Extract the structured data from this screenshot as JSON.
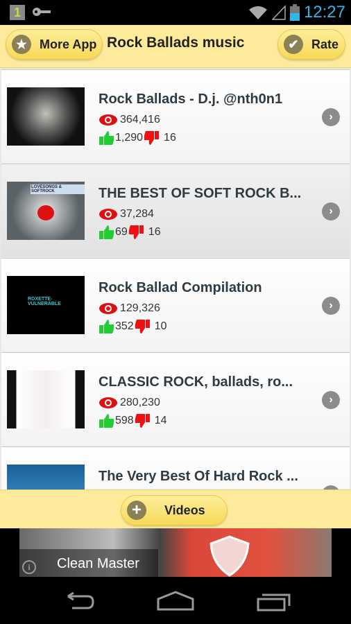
{
  "status_bar": {
    "notification": "1",
    "time": "12:27",
    "icons": [
      "key-icon",
      "wifi-icon",
      "signal-icon",
      "battery-icon"
    ]
  },
  "header": {
    "more_app_label": "More App",
    "title": "Rock Ballads music",
    "rate_label": "Rate"
  },
  "items": [
    {
      "title": "Rock Ballads - D.j. @nth0n1",
      "views": "364,416",
      "likes": "1,290",
      "dislikes": "16"
    },
    {
      "title": "THE BEST OF SOFT ROCK B...",
      "views": "37,284",
      "likes": "69",
      "dislikes": "16",
      "thumb_text": "LOVESONGS & SOFTROCK"
    },
    {
      "title": "Rock Ballad Compilation",
      "views": "129,326",
      "likes": "352",
      "dislikes": "10",
      "thumb_text": "ROXETTE-\nVULNERABLE"
    },
    {
      "title": "CLASSIC ROCK, ballads, ro...",
      "views": "280,230",
      "likes": "598",
      "dislikes": "14"
    },
    {
      "title": "The Very Best Of Hard Rock ...",
      "views": "",
      "likes": "",
      "dislikes": ""
    }
  ],
  "footer": {
    "videos_label": "Videos"
  },
  "ad": {
    "brand": "Clean Master",
    "info": "i"
  },
  "colors": {
    "header_bg": "#fdeb9b",
    "time": "#33b5e5",
    "like": "#22cc33",
    "dislike": "#ee1111",
    "views": "#dd1111"
  }
}
